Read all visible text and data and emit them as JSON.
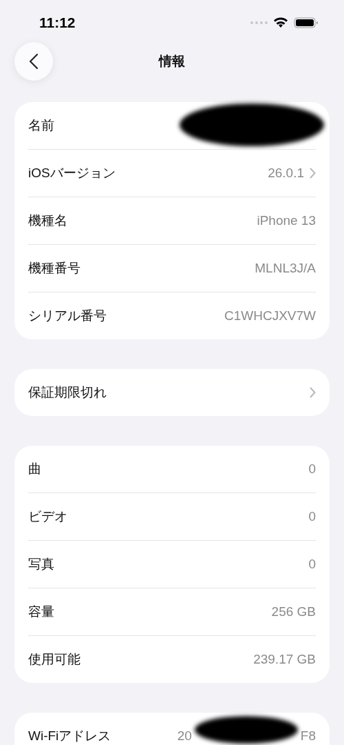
{
  "status_bar": {
    "time": "11:12"
  },
  "nav": {
    "title": "情報"
  },
  "sections": [
    {
      "rows": [
        {
          "label": "名前",
          "value_parts": [],
          "chevron": false,
          "redacted": true
        },
        {
          "label": "iOSバージョン",
          "value_parts": [
            "26.0.1"
          ],
          "chevron": true,
          "redacted": false
        },
        {
          "label": "機種名",
          "value_parts": [
            "iPhone 13"
          ],
          "chevron": false,
          "redacted": false
        },
        {
          "label": "機種番号",
          "value_parts": [
            "MLNL3J/A"
          ],
          "chevron": false,
          "redacted": false
        },
        {
          "label": "シリアル番号",
          "value_parts": [
            "C1WHCJXV7W"
          ],
          "chevron": false,
          "redacted": false
        }
      ]
    },
    {
      "rows": [
        {
          "label": "保証期限切れ",
          "value_parts": [],
          "chevron": true,
          "redacted": false
        }
      ]
    },
    {
      "rows": [
        {
          "label": "曲",
          "value_parts": [
            "0"
          ],
          "chevron": false,
          "redacted": false
        },
        {
          "label": "ビデオ",
          "value_parts": [
            "0"
          ],
          "chevron": false,
          "redacted": false
        },
        {
          "label": "写真",
          "value_parts": [
            "0"
          ],
          "chevron": false,
          "redacted": false
        },
        {
          "label": "容量",
          "value_parts": [
            "256 GB"
          ],
          "chevron": false,
          "redacted": false
        },
        {
          "label": "使用可能",
          "value_parts": [
            "239.17 GB"
          ],
          "chevron": false,
          "redacted": false
        }
      ]
    },
    {
      "rows": [
        {
          "label": "Wi-Fiアドレス",
          "value_parts": [
            "20",
            "F8"
          ],
          "chevron": false,
          "redacted": true
        }
      ]
    }
  ]
}
